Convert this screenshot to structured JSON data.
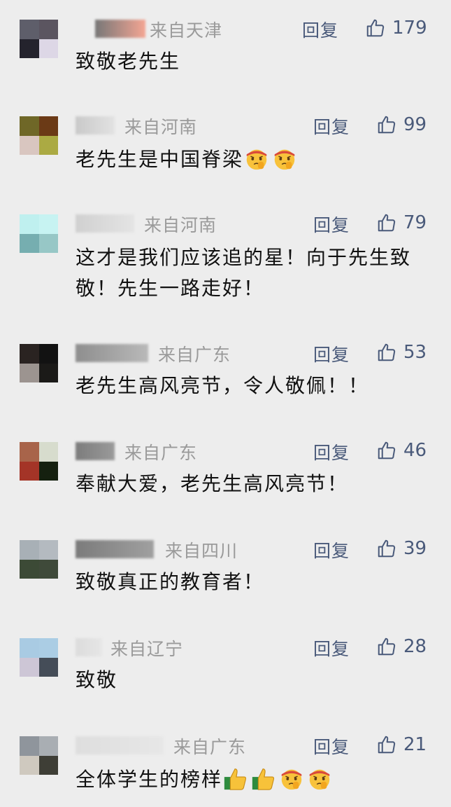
{
  "reply_label": "回复",
  "comments": [
    {
      "location": "来自天津",
      "likes": "179",
      "text": "致敬老先生",
      "emojis": [],
      "avatar_colors": [
        "#5e5e6a",
        "#5b5560",
        "#24232d",
        "#ddd7e6"
      ],
      "name_colors": [
        "#777",
        "#f4a593"
      ]
    },
    {
      "location": "来自河南",
      "likes": "99",
      "text": "老先生是中国脊梁",
      "emojis": [
        "salute-face-emoji",
        "salute-face-emoji"
      ],
      "avatar_colors": [
        "#6f6727",
        "#6b3a16",
        "#d9c6c0",
        "#abaa43"
      ],
      "name_colors": [
        "#c9c9c9",
        "#e2e2e2"
      ]
    },
    {
      "location": "来自河南",
      "likes": "79",
      "text": "这才是我们应该追的星！向于先生致敬！先生一路走好！",
      "emojis": [],
      "avatar_colors": [
        "#bff0ef",
        "#c7f3f2",
        "#76aeb0",
        "#97c7c6"
      ],
      "name_colors": [
        "#d0d0d0",
        "#e4e4e4"
      ]
    },
    {
      "location": "来自广东",
      "likes": "53",
      "text": "老先生高风亮节，令人敬佩！！",
      "emojis": [],
      "avatar_colors": [
        "#2a2321",
        "#121212",
        "#9c9490",
        "#1b1a18"
      ],
      "name_colors": [
        "#8e8e8e",
        "#b9b9b9"
      ]
    },
    {
      "location": "来自广东",
      "likes": "46",
      "text": "奉献大爱，老先生高风亮节！",
      "emojis": [],
      "avatar_colors": [
        "#a8644a",
        "#d7dccd",
        "#a43427",
        "#15200f"
      ],
      "name_colors": [
        "#7c7c7c",
        "#9a9a9a"
      ]
    },
    {
      "location": "来自四川",
      "likes": "39",
      "text": "致敬真正的教育者！",
      "emojis": [],
      "avatar_colors": [
        "#a8b0b6",
        "#b4bac0",
        "#3c4a36",
        "#3f4a3a"
      ],
      "name_colors": [
        "#7b7b7b",
        "#a0a0a0"
      ]
    },
    {
      "location": "来自辽宁",
      "likes": "28",
      "text": "致敬",
      "emojis": [],
      "avatar_colors": [
        "#a9cbe3",
        "#abcde4",
        "#cdc6d6",
        "#454d58"
      ],
      "name_colors": [
        "#dcdcdc",
        "#e6e6e6"
      ]
    },
    {
      "location": "来自广东",
      "likes": "21",
      "text": "全体学生的榜样",
      "emojis": [
        "thumbs-up-emoji",
        "thumbs-up-emoji",
        "salute-face-emoji",
        "salute-face-emoji"
      ],
      "avatar_colors": [
        "#8f959c",
        "#a9aeb3",
        "#cfc9bf",
        "#3e3e36"
      ],
      "name_colors": [
        "#dedede",
        "#e7e7e7"
      ]
    }
  ]
}
